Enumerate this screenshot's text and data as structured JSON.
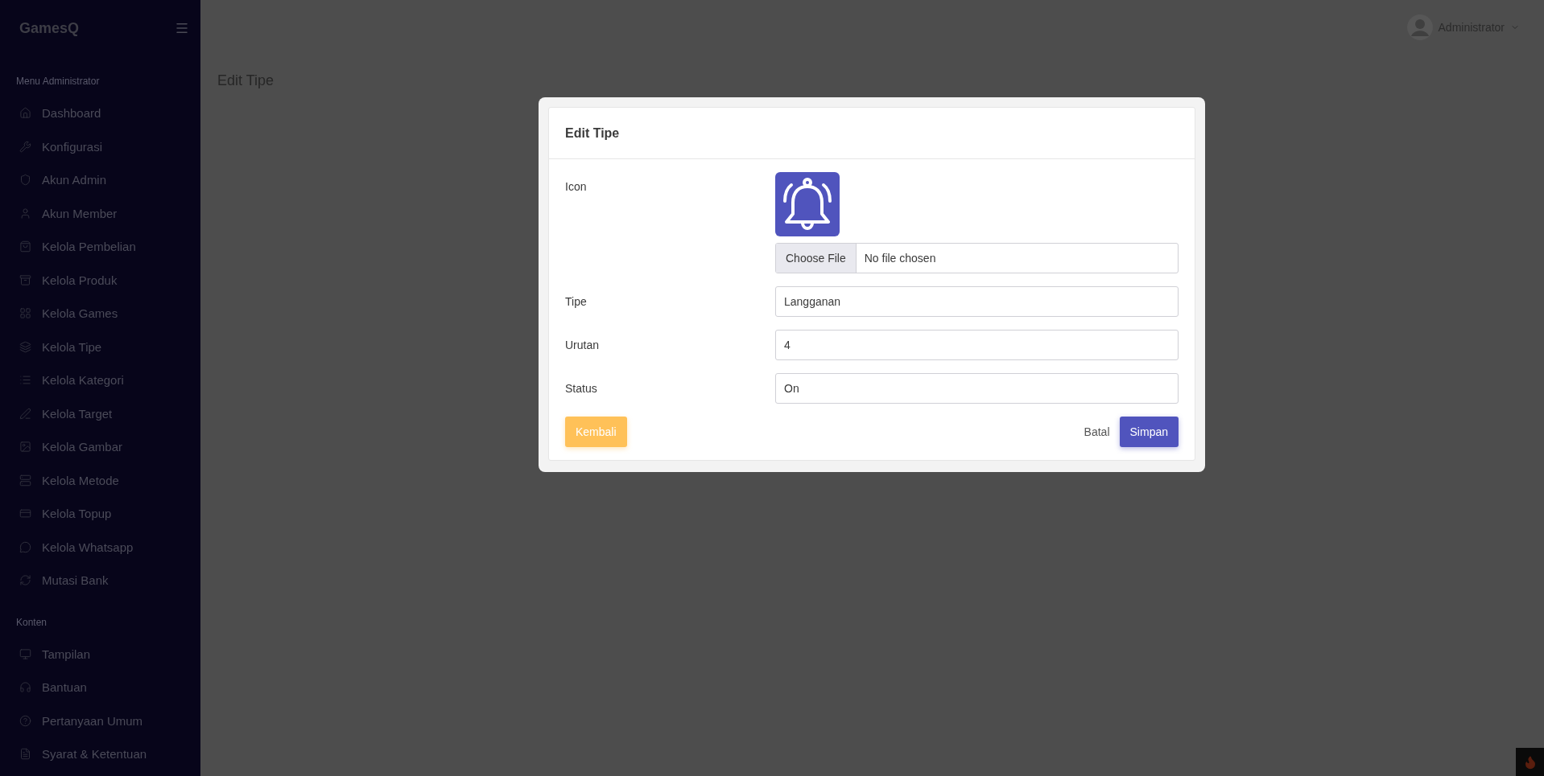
{
  "sidebar": {
    "brand": "GamesQ",
    "sections": [
      {
        "title": "Menu Administrator",
        "items": [
          {
            "label": "Dashboard"
          },
          {
            "label": "Konfigurasi"
          },
          {
            "label": "Akun Admin"
          },
          {
            "label": "Akun Member"
          },
          {
            "label": "Kelola Pembelian"
          },
          {
            "label": "Kelola Produk"
          },
          {
            "label": "Kelola Games"
          },
          {
            "label": "Kelola Tipe"
          },
          {
            "label": "Kelola Kategori"
          },
          {
            "label": "Kelola Target"
          },
          {
            "label": "Kelola Gambar"
          },
          {
            "label": "Kelola Metode"
          },
          {
            "label": "Kelola Topup"
          },
          {
            "label": "Kelola Whatsapp"
          },
          {
            "label": "Mutasi Bank"
          }
        ]
      },
      {
        "title": "Konten",
        "items": [
          {
            "label": "Tampilan"
          },
          {
            "label": "Bantuan"
          },
          {
            "label": "Pertanyaan Umum"
          },
          {
            "label": "Syarat & Ketentuan"
          }
        ]
      }
    ]
  },
  "header": {
    "user": "Administrator"
  },
  "page_title": "Edit Tipe",
  "dialog": {
    "title": "Edit Tipe",
    "fields": [
      {
        "kind": "file",
        "label": "Icon",
        "button": "Choose File",
        "value": "No file chosen"
      },
      {
        "kind": "text",
        "label": "Tipe",
        "value": "Langganan"
      },
      {
        "kind": "text",
        "label": "Urutan",
        "value": "4"
      },
      {
        "kind": "text",
        "label": "Status",
        "value": "On"
      }
    ],
    "back_button": "Kembali",
    "cancel_button": "Batal",
    "save_button": "Simpan"
  }
}
